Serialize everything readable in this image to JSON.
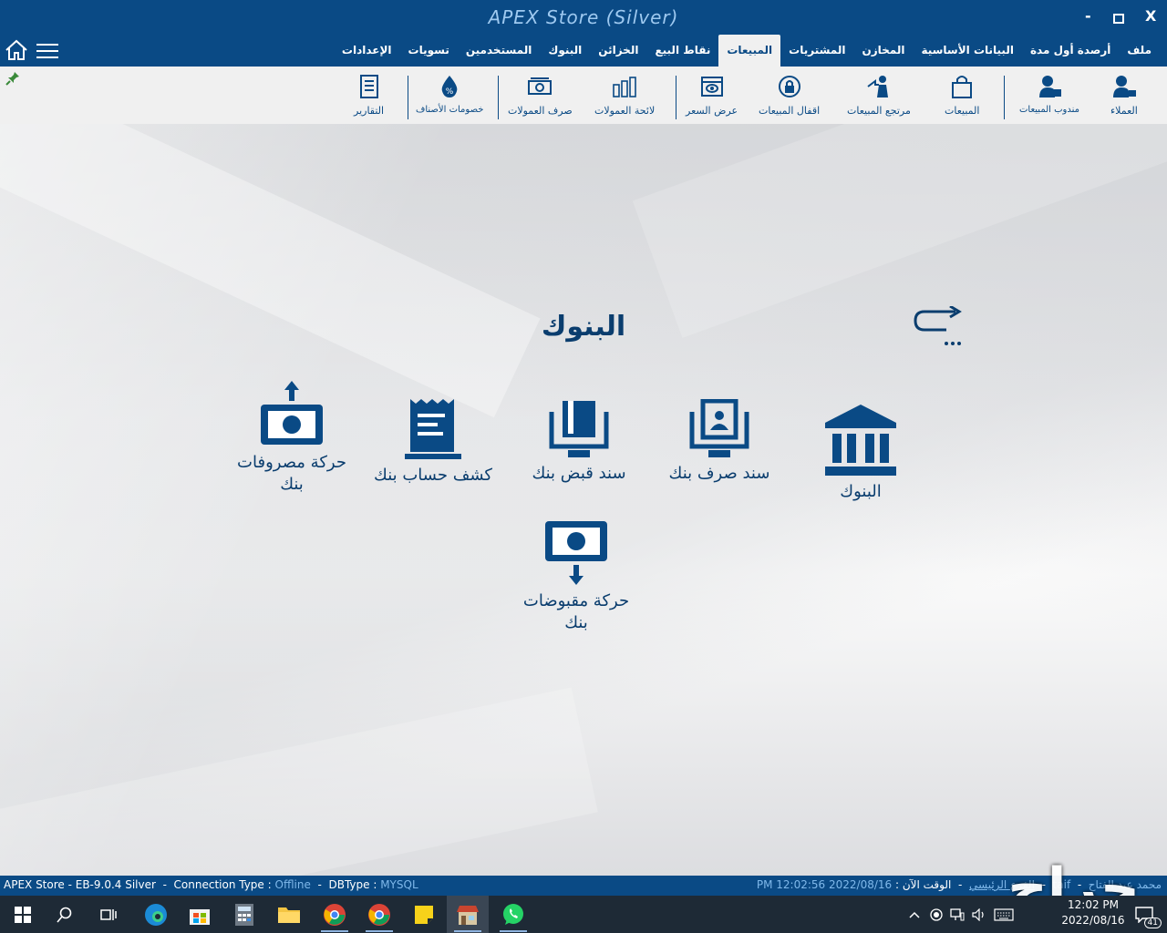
{
  "window": {
    "title": "APEX Store (Silver)",
    "minimize": "-",
    "maximize": "□",
    "close": "X"
  },
  "tabs": [
    {
      "label": "ملف",
      "active": false
    },
    {
      "label": "أرصدة أول مدة",
      "active": false
    },
    {
      "label": "البيانات الأساسية",
      "active": false
    },
    {
      "label": "المخازن",
      "active": false
    },
    {
      "label": "المشتريات",
      "active": false
    },
    {
      "label": "المبيعات",
      "active": true
    },
    {
      "label": "نقاط البيع",
      "active": false
    },
    {
      "label": "الخزائن",
      "active": false
    },
    {
      "label": "البنوك",
      "active": false
    },
    {
      "label": "المستخدمين",
      "active": false
    },
    {
      "label": "تسويات",
      "active": false
    },
    {
      "label": "الإعدادات",
      "active": false
    }
  ],
  "ribbon": [
    {
      "label": "العملاء",
      "icon": "customer-icon"
    },
    {
      "label": "مندوب المبيعات",
      "icon": "sales-rep-icon"
    },
    {
      "label": "المبيعات",
      "icon": "shopping-bag-icon"
    },
    {
      "label": "مرتجع المبيعات",
      "icon": "sales-return-icon"
    },
    {
      "label": "اقفال المبيعات",
      "icon": "lock-icon"
    },
    {
      "label": "عرض السعر",
      "icon": "price-quote-icon"
    },
    {
      "label": "لائحة العمولات",
      "icon": "coins-icon"
    },
    {
      "label": "صرف العمولات",
      "icon": "cash-icon"
    },
    {
      "label": "خصومات الأصناف",
      "icon": "discount-icon"
    },
    {
      "label": "التقارير",
      "icon": "reports-icon"
    }
  ],
  "page": {
    "title": "البنوك",
    "back": "..."
  },
  "tiles": [
    {
      "label": "البنوك",
      "icon": "bank-building-icon"
    },
    {
      "label": "سند صرف بنك",
      "icon": "bank-payment-voucher-icon"
    },
    {
      "label": "سند قبض بنك",
      "icon": "bank-receipt-voucher-icon"
    },
    {
      "label": "كشف حساب بنك",
      "icon": "bank-statement-icon"
    },
    {
      "label": "حركة مصروفات بنك",
      "icon": "bank-expenses-icon"
    },
    {
      "label": "حركة مقبوضات بنك",
      "icon": "bank-receipts-icon"
    }
  ],
  "status": {
    "app": "APEX Store - EB-9.0.4 Silver",
    "connection_label": "Connection Type :",
    "connection_value": "Offline",
    "db_label": "DBType :",
    "db_value": "MYSQL",
    "time_label": "الوقت الآن :",
    "time_value": "2022/08/16 12:02:56 PM",
    "branch": "الفرع الرئيسي",
    "city": "taif",
    "user": "محمد عبد الفتاح",
    "sep": "-"
  },
  "taskbar": {
    "clock_time": "12:02 PM",
    "clock_date": "2022/08/16",
    "notifications": "41"
  },
  "watermark": "حراج",
  "colors": {
    "brand": "#0a4a85",
    "accent": "#0a3d6e",
    "tab_active_bg": "#f0f0f0"
  }
}
